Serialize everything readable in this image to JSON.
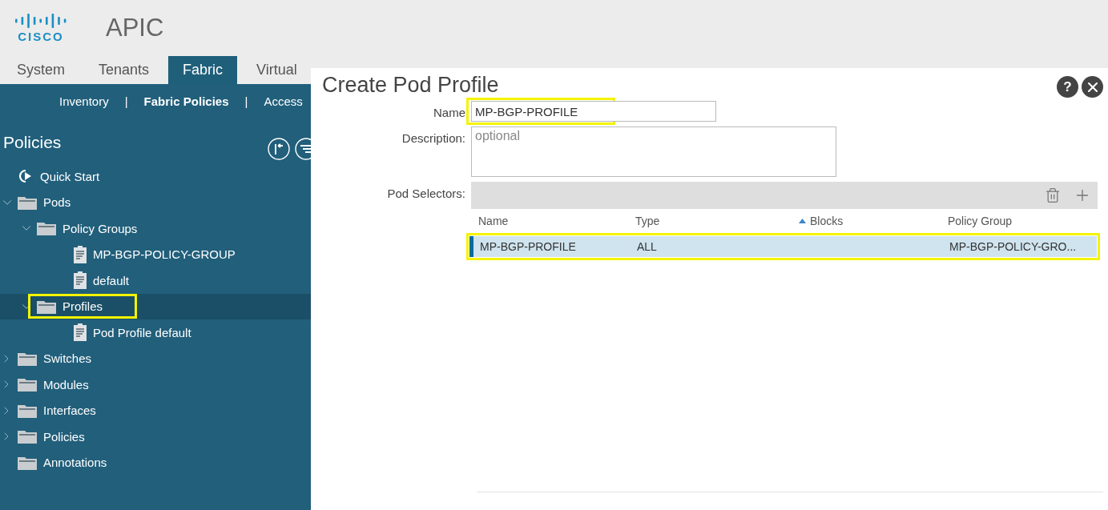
{
  "header": {
    "logo": "CISCO",
    "app_title": "APIC"
  },
  "tabs": [
    {
      "label": "System",
      "selected": false
    },
    {
      "label": "Tenants",
      "selected": false
    },
    {
      "label": "Fabric",
      "selected": true
    },
    {
      "label": "Virtual",
      "selected": false
    }
  ],
  "subnav": [
    {
      "label": "Inventory",
      "selected": false
    },
    {
      "label": "Fabric Policies",
      "selected": true
    },
    {
      "label": "Access",
      "selected": false
    }
  ],
  "subnav_separator": "|",
  "sidebar": {
    "title": "Policies",
    "tree": [
      {
        "label": "Quick Start",
        "kind": "quickstart"
      },
      {
        "label": "Pods",
        "kind": "folder",
        "expanded": true,
        "selected": false,
        "children": [
          {
            "label": "Policy Groups",
            "kind": "folder",
            "expanded": true,
            "selected": false,
            "children": [
              {
                "label": "MP-BGP-POLICY-GROUP",
                "kind": "doc"
              },
              {
                "label": "default",
                "kind": "doc"
              }
            ]
          },
          {
            "label": "Profiles",
            "kind": "folder",
            "expanded": true,
            "selected": true,
            "highlighted": true,
            "children": [
              {
                "label": "Pod Profile default",
                "kind": "doc"
              }
            ]
          }
        ]
      },
      {
        "label": "Switches",
        "kind": "folder",
        "expanded": false,
        "selected": false
      },
      {
        "label": "Modules",
        "kind": "folder",
        "expanded": false,
        "selected": false
      },
      {
        "label": "Interfaces",
        "kind": "folder",
        "expanded": false,
        "selected": false
      },
      {
        "label": "Policies",
        "kind": "folder",
        "expanded": false,
        "selected": false
      },
      {
        "label": "Annotations",
        "kind": "leaf-folder",
        "selected": false
      }
    ]
  },
  "dialog": {
    "title": "Create Pod Profile",
    "help": "?",
    "fields": [
      {
        "label": "Name",
        "value": "MP-BGP-PROFILE",
        "kind": "input",
        "highlighted": true
      },
      {
        "label": "Description:",
        "placeholder": "optional",
        "kind": "textarea",
        "highlighted": false
      }
    ],
    "selectors": {
      "label": "Pod Selectors:",
      "columns": [
        {
          "label": "Name",
          "sorted": false
        },
        {
          "label": "Type",
          "sorted": false
        },
        {
          "label": "Blocks",
          "sorted": true
        },
        {
          "label": "Policy Group",
          "sorted": false
        }
      ],
      "rows": [
        {
          "cells": [
            "MP-BGP-PROFILE",
            "ALL",
            "",
            "MP-BGP-POLICY-GRO..."
          ],
          "selected": true,
          "highlighted": true
        }
      ]
    }
  }
}
